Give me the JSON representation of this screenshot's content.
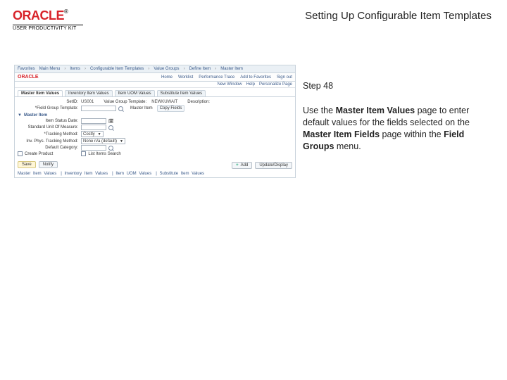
{
  "header": {
    "logo_text": "ORACLE",
    "logo_reg": "®",
    "upk_label": "USER PRODUCTIVITY KIT",
    "title": "Setting Up Configurable Item Templates"
  },
  "right": {
    "step_label": "Step 48",
    "instr_1": "Use the ",
    "instr_b1": "Master Item Values",
    "instr_2": " page to enter default values for the fields selected on the ",
    "instr_b2": "Master Item Fields",
    "instr_3": " page within the ",
    "instr_b3": "Field Groups",
    "instr_4": " menu."
  },
  "shot": {
    "crumb_favorites": "Favorites",
    "crumb_mainmenu": "Main Menu",
    "crumb_items": "Items",
    "crumb_cit": "Configurable Item Templates",
    "crumb_vm": "Value Groups",
    "crumb_di": "Define Item",
    "crumb_mi": "Master Item",
    "hdr2_logo": "ORACLE",
    "hdr2_home": "Home",
    "hdr2_worklist": "Worklist",
    "hdr2_perf": "Performance Trace",
    "hdr2_addfav": "Add to Favorites",
    "hdr2_signout": "Sign out",
    "hdr3_newwin": "New Window",
    "hdr3_help": "Help",
    "hdr3_pers": "Personalize Page",
    "tabs": {
      "t1": "Master Item Values",
      "t2": "Inventory Item Values",
      "t3": "Item UOM Values",
      "t4": "Substitute Item Values"
    },
    "fields": {
      "setid_lbl": "SetID:",
      "setid_val": "US001",
      "template_lbl": "Value Group Template:",
      "template_val": "NEWKUWAIT",
      "desc_lbl": "Description:",
      "fieldgroup_lbl": "*Field Group Template:",
      "master_item_lbl": "Master Item",
      "copy_fields": "Copy Fields",
      "section_master": "Master Item",
      "itemstatus_lbl": "Item Status Date:",
      "uom_lbl": "Standard Unit Of Measure:",
      "tracking_lbl": "*Tracking Method:",
      "tracking_val": "Costly",
      "invtrack_lbl": "Inv. Phys. Tracking Method:",
      "invtrack_val": "None  n/a (default)",
      "cat_lbl": "Default Category:",
      "create_prod": "Create Product",
      "list_placehold": "List Items Search",
      "save": "Save",
      "notify": "Notify",
      "add": "Add",
      "update": "Update/Display",
      "footer_t1": "Master Item Values",
      "footer_t2": "Inventory Item Values",
      "footer_t3": "Item UOM Values",
      "footer_t4": "Substitute Item Values"
    }
  }
}
